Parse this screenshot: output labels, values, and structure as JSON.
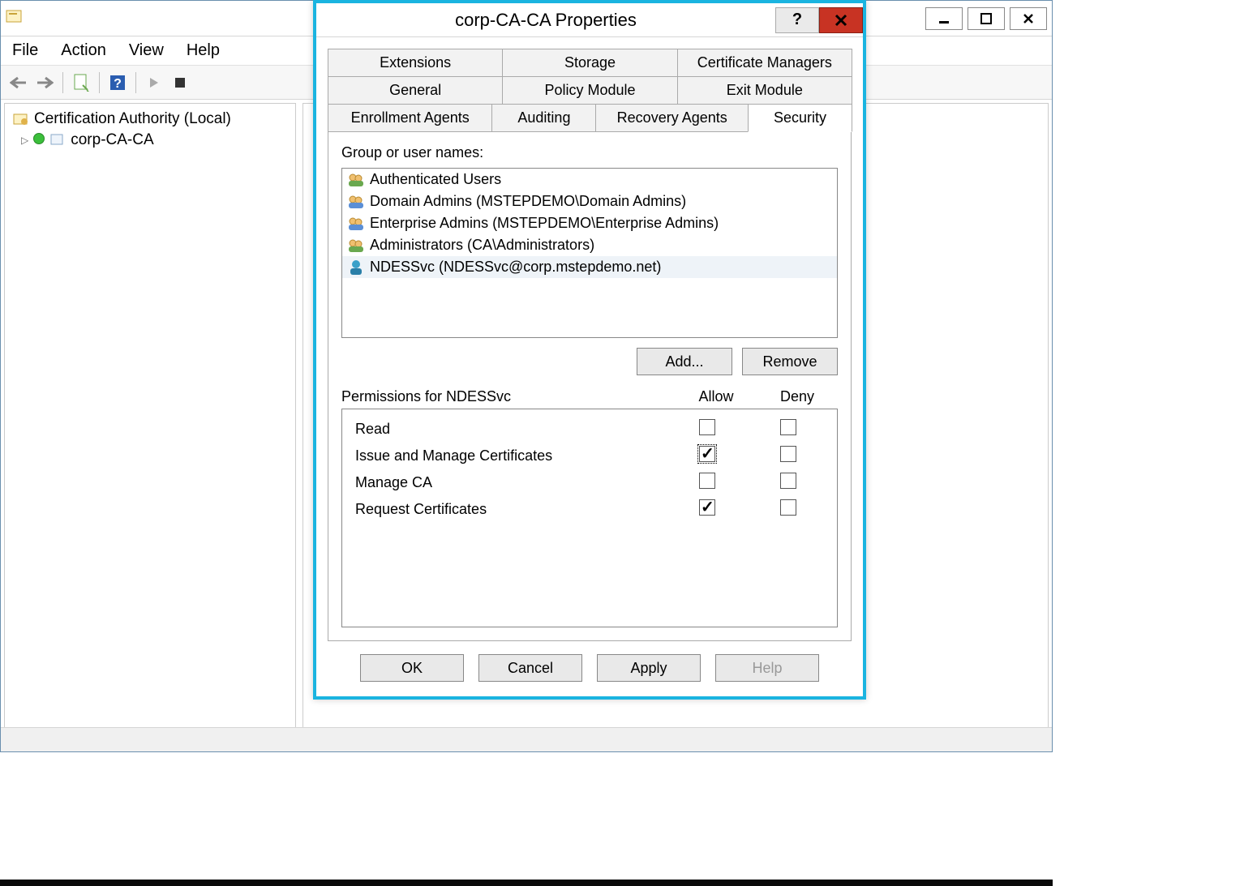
{
  "main_window": {
    "menu": {
      "file": "File",
      "action": "Action",
      "view": "View",
      "help": "Help"
    },
    "tree": {
      "root": "Certification Authority (Local)",
      "child": "corp-CA-CA"
    }
  },
  "dialog": {
    "title": "corp-CA-CA Properties",
    "tabs": {
      "row1": [
        "Extensions",
        "Storage",
        "Certificate Managers"
      ],
      "row2": [
        "General",
        "Policy Module",
        "Exit Module"
      ],
      "row3": [
        "Enrollment Agents",
        "Auditing",
        "Recovery Agents",
        "Security"
      ]
    },
    "group_label": "Group or user names:",
    "users": [
      "Authenticated Users",
      "Domain Admins (MSTEPDEMO\\Domain Admins)",
      "Enterprise Admins (MSTEPDEMO\\Enterprise Admins)",
      "Administrators (CA\\Administrators)",
      "NDESSvc (NDESSvc@corp.mstepdemo.net)"
    ],
    "btn_add": "Add...",
    "btn_remove": "Remove",
    "perm_label": "Permissions for NDESSvc",
    "col_allow": "Allow",
    "col_deny": "Deny",
    "permissions": [
      {
        "name": "Read",
        "allow": false,
        "deny": false,
        "focus": false
      },
      {
        "name": "Issue and Manage Certificates",
        "allow": true,
        "deny": false,
        "focus": true
      },
      {
        "name": "Manage CA",
        "allow": false,
        "deny": false,
        "focus": false
      },
      {
        "name": "Request Certificates",
        "allow": true,
        "deny": false,
        "focus": false
      }
    ],
    "btn_ok": "OK",
    "btn_cancel": "Cancel",
    "btn_apply": "Apply",
    "btn_help": "Help"
  }
}
